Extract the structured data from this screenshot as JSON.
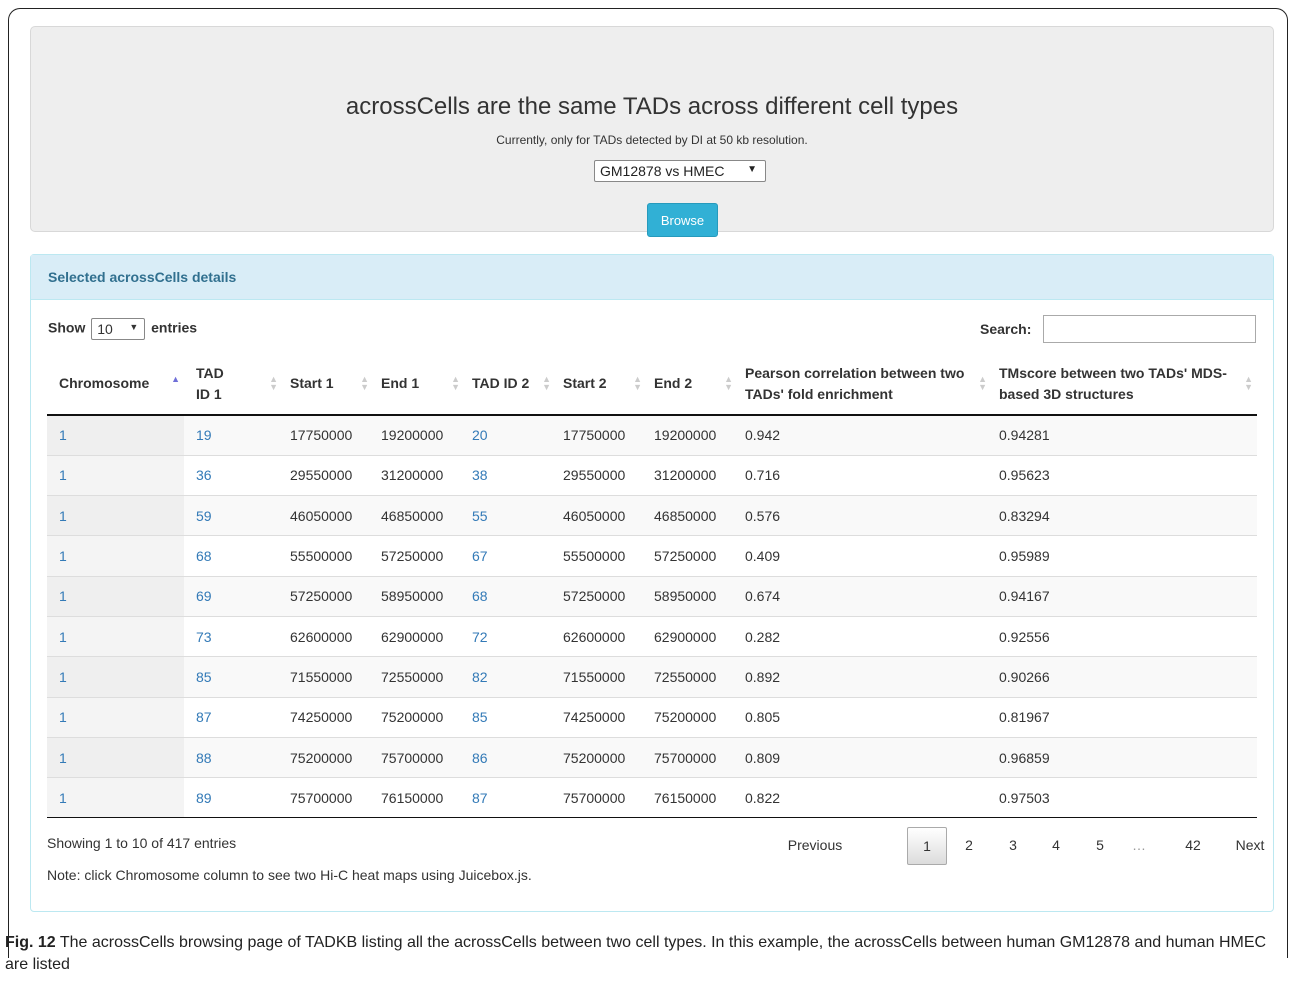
{
  "header": {
    "title": "acrossCells are the same TADs across different cell types",
    "subtitle": "Currently, only for TADs detected by DI at 50 kb resolution.",
    "selected_pair": "GM12878 vs HMEC",
    "browse_label": "Browse"
  },
  "panel": {
    "heading": "Selected acrossCells details",
    "show_label": "Show",
    "entries_value": "10",
    "entries_label": "entries",
    "search_label": "Search:",
    "search_value": ""
  },
  "table": {
    "columns": [
      "Chromosome",
      "TAD ID 1",
      "Start 1",
      "End 1",
      "TAD ID 2",
      "Start 2",
      "End 2",
      "Pearson correlation between two TADs' fold enrichment",
      "TMscore between two TADs' MDS-based 3D structures"
    ],
    "rows": [
      [
        "1",
        "19",
        "17750000",
        "19200000",
        "20",
        "17750000",
        "19200000",
        "0.942",
        "0.94281"
      ],
      [
        "1",
        "36",
        "29550000",
        "31200000",
        "38",
        "29550000",
        "31200000",
        "0.716",
        "0.95623"
      ],
      [
        "1",
        "59",
        "46050000",
        "46850000",
        "55",
        "46050000",
        "46850000",
        "0.576",
        "0.83294"
      ],
      [
        "1",
        "68",
        "55500000",
        "57250000",
        "67",
        "55500000",
        "57250000",
        "0.409",
        "0.95989"
      ],
      [
        "1",
        "69",
        "57250000",
        "58950000",
        "68",
        "57250000",
        "58950000",
        "0.674",
        "0.94167"
      ],
      [
        "1",
        "73",
        "62600000",
        "62900000",
        "72",
        "62600000",
        "62900000",
        "0.282",
        "0.92556"
      ],
      [
        "1",
        "85",
        "71550000",
        "72550000",
        "82",
        "71550000",
        "72550000",
        "0.892",
        "0.90266"
      ],
      [
        "1",
        "87",
        "74250000",
        "75200000",
        "85",
        "74250000",
        "75200000",
        "0.805",
        "0.81967"
      ],
      [
        "1",
        "88",
        "75200000",
        "75700000",
        "86",
        "75200000",
        "75700000",
        "0.809",
        "0.96859"
      ],
      [
        "1",
        "89",
        "75700000",
        "76150000",
        "87",
        "75700000",
        "76150000",
        "0.822",
        "0.97503"
      ]
    ]
  },
  "footer": {
    "info": "Showing 1 to 10 of 417 entries",
    "note": "Note: click Chromosome column to see two Hi-C heat maps using Juicebox.js.",
    "pagination": {
      "previous": "Previous",
      "pages": [
        "1",
        "2",
        "3",
        "4",
        "5",
        "…",
        "42"
      ],
      "current": "1",
      "next": "Next"
    }
  },
  "caption": {
    "label": "Fig. 12",
    "text": "The acrossCells browsing page of TADKB listing all the acrossCells between two cell types. In this example, the acrossCells between human GM12878 and human HMEC are listed"
  }
}
